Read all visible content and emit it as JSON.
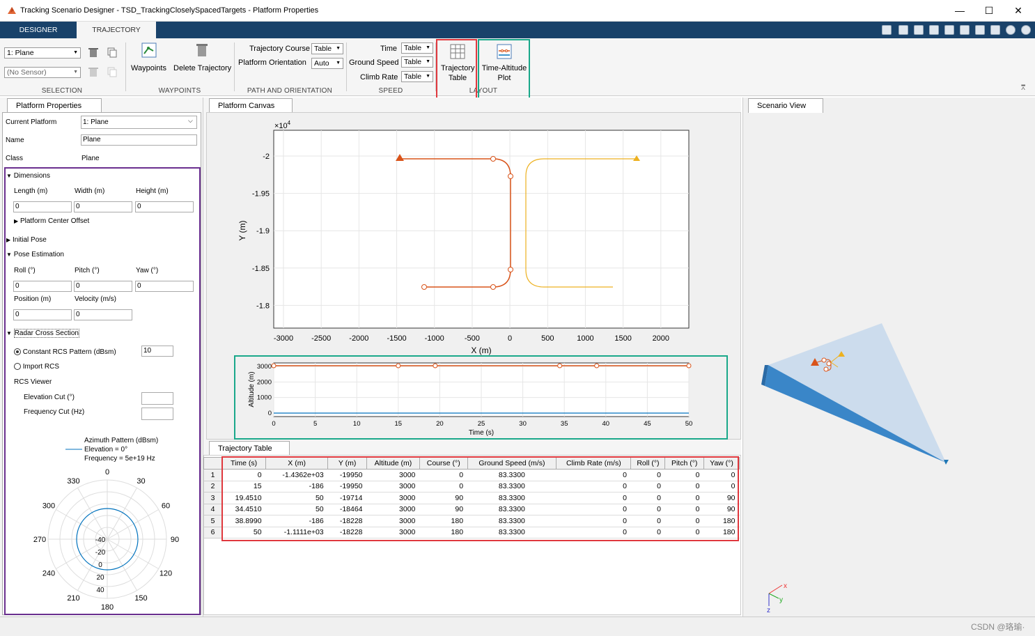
{
  "window": {
    "title": "Tracking Scenario Designer - TSD_TrackingCloselySpacedTargets - Platform Properties",
    "minimize": "—",
    "maximize": "☐",
    "close": "✕"
  },
  "tabs": {
    "designer": "DESIGNER",
    "trajectory": "TRAJECTORY"
  },
  "ribbon": {
    "selection": {
      "platform": "1: Plane",
      "sensor": "(No Sensor)",
      "label": "SELECTION"
    },
    "waypoints": {
      "waypoints_label": "Waypoints",
      "delete_label": "Delete Trajectory",
      "label": "WAYPOINTS"
    },
    "path": {
      "course_label": "Trajectory Course",
      "course_value": "Table",
      "orientation_label": "Platform Orientation",
      "orientation_value": "Auto",
      "label": "PATH AND ORIENTATION"
    },
    "speed": {
      "time_label": "Time",
      "time_value": "Table",
      "ground_label": "Ground Speed",
      "ground_value": "Table",
      "climb_label": "Climb Rate",
      "climb_value": "Table",
      "label": "SPEED"
    },
    "layout": {
      "traj_table_1": "Trajectory",
      "traj_table_2": "Table",
      "time_alt_1": "Time-Altitude",
      "time_alt_2": "Plot",
      "label": "LAYOUT"
    }
  },
  "properties": {
    "tab": "Platform Properties",
    "current_platform_label": "Current Platform",
    "current_platform": "1: Plane",
    "name_label": "Name",
    "name": "Plane",
    "class_label": "Class",
    "class": "Plane",
    "dimensions": "Dimensions",
    "length_label": "Length (m)",
    "width_label": "Width (m)",
    "height_label": "Height (m)",
    "length": "0",
    "width": "0",
    "height": "0",
    "center_offset": "Platform Center Offset",
    "initial_pose": "Initial Pose",
    "pose_estimation": "Pose Estimation",
    "roll_label": "Roll (°)",
    "pitch_label": "Pitch (°)",
    "yaw_label": "Yaw (°)",
    "roll": "0",
    "pitch": "0",
    "yaw": "0",
    "position_label": "Position (m)",
    "velocity_label": "Velocity (m/s)",
    "position": "0",
    "velocity": "0",
    "rcs_section": "Radar Cross Section",
    "constant_rcs": "Constant RCS Pattern (dBsm)",
    "constant_rcs_value": "10",
    "import_rcs": "Import RCS",
    "rcs_viewer": "RCS Viewer",
    "elev_cut": "Elevation Cut (°)",
    "freq_cut": "Frequency Cut (Hz)",
    "polar": {
      "legend_title": "Azimuth Pattern (dBsm)",
      "legend_line1": "Elevation = 0°",
      "legend_line2": "Frequency = 5e+19 Hz",
      "angles": [
        "0",
        "30",
        "60",
        "90",
        "120",
        "150",
        "180",
        "210",
        "240",
        "270",
        "300",
        "330"
      ],
      "radii": [
        "-40",
        "-20",
        "0",
        "20",
        "40"
      ]
    }
  },
  "canvas": {
    "tab": "Platform Canvas",
    "exponent": "×10",
    "exponent_power": "4",
    "xlabel": "X (m)",
    "ylabel": "Y (m)",
    "xticks": [
      "-3000",
      "-2500",
      "-2000",
      "-1500",
      "-1000",
      "-500",
      "0",
      "500",
      "1000",
      "1500",
      "2000"
    ],
    "yticks": [
      "-2",
      "-1.95",
      "-1.9",
      "-1.85",
      "-1.8"
    ],
    "colors": {
      "plane": "#d95319",
      "other": "#edb120",
      "alt": "#0072bd"
    }
  },
  "altitude_plot": {
    "xlabel": "Time (s)",
    "ylabel": "Altitude (m)",
    "xticks": [
      "0",
      "5",
      "10",
      "15",
      "20",
      "25",
      "30",
      "35",
      "40",
      "45",
      "50"
    ],
    "yticks": [
      "3000",
      "2000",
      "1000",
      "0"
    ]
  },
  "scenario_view": {
    "tab": "Scenario View",
    "axis_x": "x",
    "axis_y": "y",
    "axis_z": "z"
  },
  "trajectory_table": {
    "tab": "Trajectory Table",
    "columns": [
      "Time (s)",
      "X (m)",
      "Y (m)",
      "Altitude (m)",
      "Course (°)",
      "Ground Speed (m/s)",
      "Climb Rate (m/s)",
      "Roll (°)",
      "Pitch (°)",
      "Yaw (°)"
    ],
    "rows": [
      [
        "1",
        "0",
        "-1.4362e+03",
        "-19950",
        "3000",
        "0",
        "83.3300",
        "0",
        "0",
        "0",
        "0"
      ],
      [
        "2",
        "15",
        "-186",
        "-19950",
        "3000",
        "0",
        "83.3300",
        "0",
        "0",
        "0",
        "0"
      ],
      [
        "3",
        "19.4510",
        "50",
        "-19714",
        "3000",
        "90",
        "83.3300",
        "0",
        "0",
        "0",
        "90"
      ],
      [
        "4",
        "34.4510",
        "50",
        "-18464",
        "3000",
        "90",
        "83.3300",
        "0",
        "0",
        "0",
        "90"
      ],
      [
        "5",
        "38.8990",
        "-186",
        "-18228",
        "3000",
        "180",
        "83.3300",
        "0",
        "0",
        "0",
        "180"
      ],
      [
        "6",
        "50",
        "-1.1111e+03",
        "-18228",
        "3000",
        "180",
        "83.3300",
        "0",
        "0",
        "0",
        "180"
      ]
    ]
  },
  "watermark": "CSDN @珞瑜·"
}
